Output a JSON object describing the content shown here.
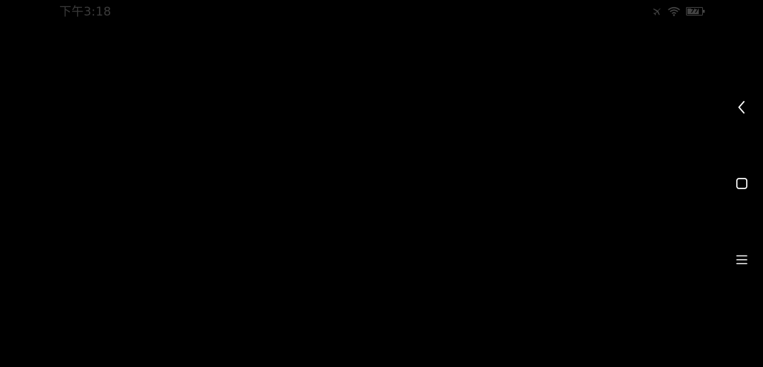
{
  "status_bar": {
    "time": "下午3:18",
    "battery_level": "77",
    "icons": [
      "airplane-icon",
      "wifi-icon",
      "battery-icon"
    ]
  },
  "navigation": {
    "buttons": [
      {
        "name": "back-icon"
      },
      {
        "name": "home-icon"
      },
      {
        "name": "menu-icon"
      }
    ]
  },
  "colors": {
    "background": "#000000",
    "status_text": "#3b3b3b",
    "nav_icon": "#ffffff",
    "status_icon": "#444444"
  }
}
